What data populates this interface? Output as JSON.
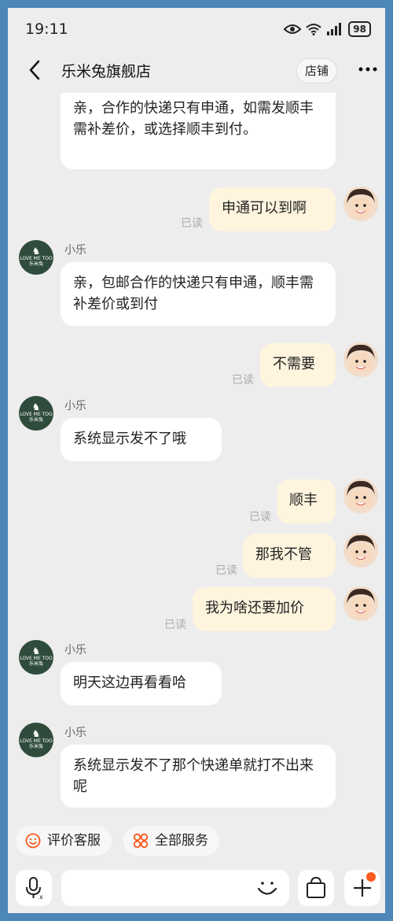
{
  "status": {
    "time": "19:11",
    "battery": "98"
  },
  "header": {
    "title": "乐米兔旗舰店",
    "shop_label": "店铺"
  },
  "bot": {
    "name": "小乐",
    "logo_line1": "LOVE ME TOO",
    "logo_line2": "乐米兔"
  },
  "messages": [
    {
      "text": "亲，合作的快递只有申通，如需发顺丰需补差价，或选择顺丰到付。"
    },
    {
      "text": "申通可以到啊",
      "read": "已读"
    },
    {
      "text": "亲，包邮合作的快递只有申通，顺丰需补差价或到付"
    },
    {
      "text": "不需要",
      "read": "已读"
    },
    {
      "text": "系统显示发不了哦"
    },
    {
      "text": "顺丰",
      "read": "已读"
    },
    {
      "text": "那我不管",
      "read": "已读"
    },
    {
      "text": "我为啥还要加价",
      "read": "已读"
    },
    {
      "text": "明天这边再看看哈"
    },
    {
      "text": "系统显示发不了那个快递单就打不出来呢"
    }
  ],
  "quick_actions": {
    "review": "评价客服",
    "services": "全部服务"
  },
  "icons": [
    "eye-icon",
    "wifi-icon",
    "signal-icon",
    "back-arrow-icon",
    "more-icon",
    "smile-icon",
    "grid-icon",
    "mic-icon",
    "emoji-icon",
    "bag-icon",
    "plus-icon"
  ],
  "colors": {
    "accent": "#ff5a1e",
    "out_bubble": "#fff4de",
    "background": "#ededed"
  }
}
